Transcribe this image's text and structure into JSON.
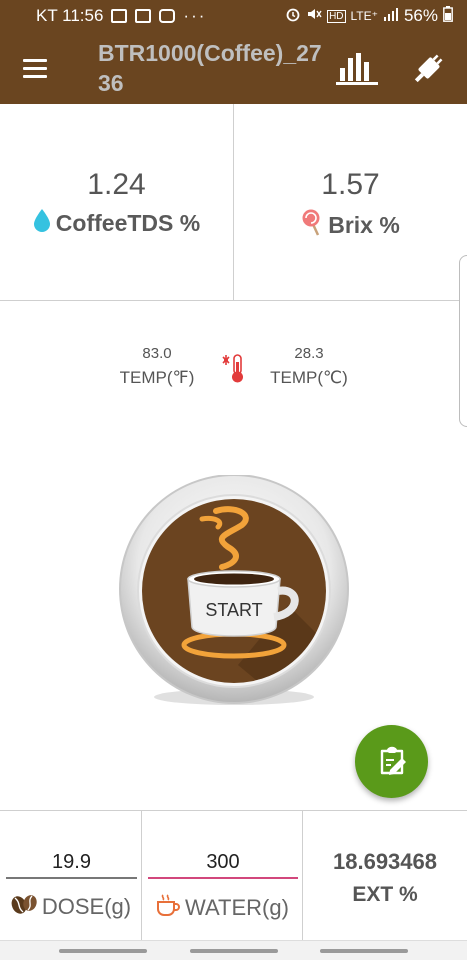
{
  "status_bar": {
    "time": "KT 11:56",
    "more": "···",
    "network": "LTE⁺",
    "battery": "56%"
  },
  "app_bar": {
    "title": "BTR1000(Coffee)_2736",
    "menu_icon": "hamburger-icon",
    "chart_icon": "bar-chart-icon",
    "bluetooth_icon": "connector-icon"
  },
  "readings": {
    "coffee_tds": {
      "value": "1.24",
      "label": "CoffeeTDS %",
      "icon": "water-drop-icon",
      "color": "#35c2e0"
    },
    "brix": {
      "value": "1.57",
      "label": "Brix %",
      "icon": "lollipop-icon",
      "color": "#e04a4a"
    }
  },
  "temperature": {
    "fahrenheit": {
      "value": "83.0",
      "label": "TEMP(℉)"
    },
    "celsius": {
      "value": "28.3",
      "label": "TEMP(℃)"
    },
    "icon": "thermometer-icon"
  },
  "start_button": {
    "label": "START",
    "icon": "coffee-cup-icon"
  },
  "fab": {
    "icon": "edit-note-icon",
    "color": "#5a9a1a"
  },
  "inputs": {
    "dose": {
      "value": "19.9",
      "label": "DOSE(g)",
      "icon": "coffee-bean-icon"
    },
    "water": {
      "value": "300",
      "label": "WATER(g)",
      "icon": "cup-icon"
    },
    "ext": {
      "value": "18.693468",
      "label": "EXT %"
    }
  },
  "colors": {
    "brand": "#6a4520",
    "accent": "#d2477c"
  }
}
